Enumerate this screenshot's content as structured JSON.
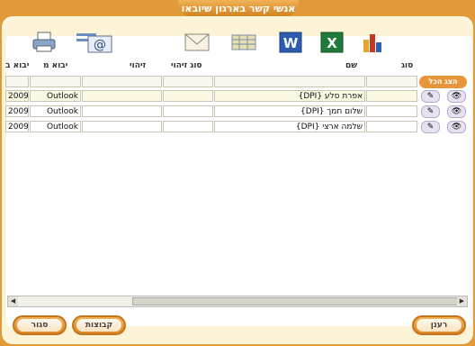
{
  "window": {
    "title": "אנשי קשר בארגון שיובאו"
  },
  "toolbar": {
    "icons": [
      "printer-icon",
      "email-export-icon",
      "envelope-icon",
      "table-icon",
      "word-icon",
      "excel-icon",
      "chart-icon"
    ]
  },
  "table": {
    "headers": {
      "type": "סוג",
      "name": "שם",
      "id_type": "סוג זיהוי",
      "id": "זיהוי",
      "imported_from": "יבוא מ",
      "import_date": "יבוא ב"
    },
    "show_all": "הצג הכל",
    "rows": [
      {
        "name": "אפרת סלע {DPI}",
        "imported_from": "Outlook",
        "import_date": "2009"
      },
      {
        "name": "שלום חמך {DPI}",
        "imported_from": "Outlook",
        "import_date": "2009"
      },
      {
        "name": "שלמה ארצי {DPI}",
        "imported_from": "Outlook",
        "import_date": "2009"
      }
    ]
  },
  "buttons": {
    "refresh": "רענן",
    "groups": "קבוצות",
    "close": "סגור"
  },
  "colors": {
    "accent": "#e19a3a",
    "panel": "#fdf3d6"
  }
}
